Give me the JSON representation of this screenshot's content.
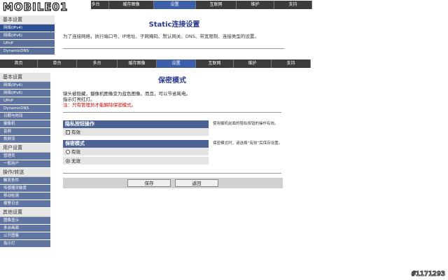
{
  "back_window": {
    "logo": "MOBILE01",
    "tabs": [
      "多台",
      "缓存图像",
      "设置",
      "互联网",
      "维护",
      "支持"
    ],
    "active_tab": 2,
    "sidebar": {
      "heading": "基本设置",
      "items": [
        "网络(IPv4)",
        "网络(IPv6)",
        "UPnP",
        "DynamicDNS"
      ]
    },
    "title": "Static连接设置",
    "description": "为了连接网络，执行端口号、IP地址、子网掩码、默认网关、DNS、带宽限制、连接类型的设置。"
  },
  "front_window": {
    "tabs": [
      "首页",
      "单台",
      "多台",
      "缓存图像",
      "设置",
      "互联网",
      "维护",
      "支持"
    ],
    "active_tab": 4,
    "sidebar": {
      "groups": [
        {
          "heading": "基本设置",
          "items": [
            "网络(IPv4)",
            "网络(IPv6)",
            "UPnP",
            "DynamicDNS",
            "日期与时间",
            "摄像机",
            "音频",
            "视频流"
          ]
        },
        {
          "heading": "用户设置",
          "items": [
            "管理员",
            "一般用户"
          ]
        },
        {
          "heading": "操作/转送",
          "items": [
            "触发条件",
            "传感器灵敏度",
            "移动检测",
            "报警日志"
          ]
        },
        {
          "heading": "其他设置",
          "items": [
            "图像显示",
            "多台画面",
            "公开图像",
            "指示灯"
          ]
        }
      ]
    },
    "title": "保密模式",
    "description_line1": "镜头被隐藏，摄像机图像变为蓝色图像。而且，可以节省耗电。",
    "description_line2": "指示灯亮红灯。",
    "note": "注：只有管理员才能解除保密模式。",
    "privacy_button_section": {
      "heading": "隐私按钮操作",
      "option_label": "有效",
      "checked": true,
      "help": "使用摄机前面的隐私按钮的操作有效。"
    },
    "privacy_mode_section": {
      "heading": "保密模式",
      "options": [
        "有效",
        "无效"
      ],
      "selected": "无效",
      "help": "保密模式时，请选择“有效”后保存设置。"
    },
    "buttons": {
      "save": "保存",
      "back": "返回"
    }
  },
  "watermark": "#1171293"
}
